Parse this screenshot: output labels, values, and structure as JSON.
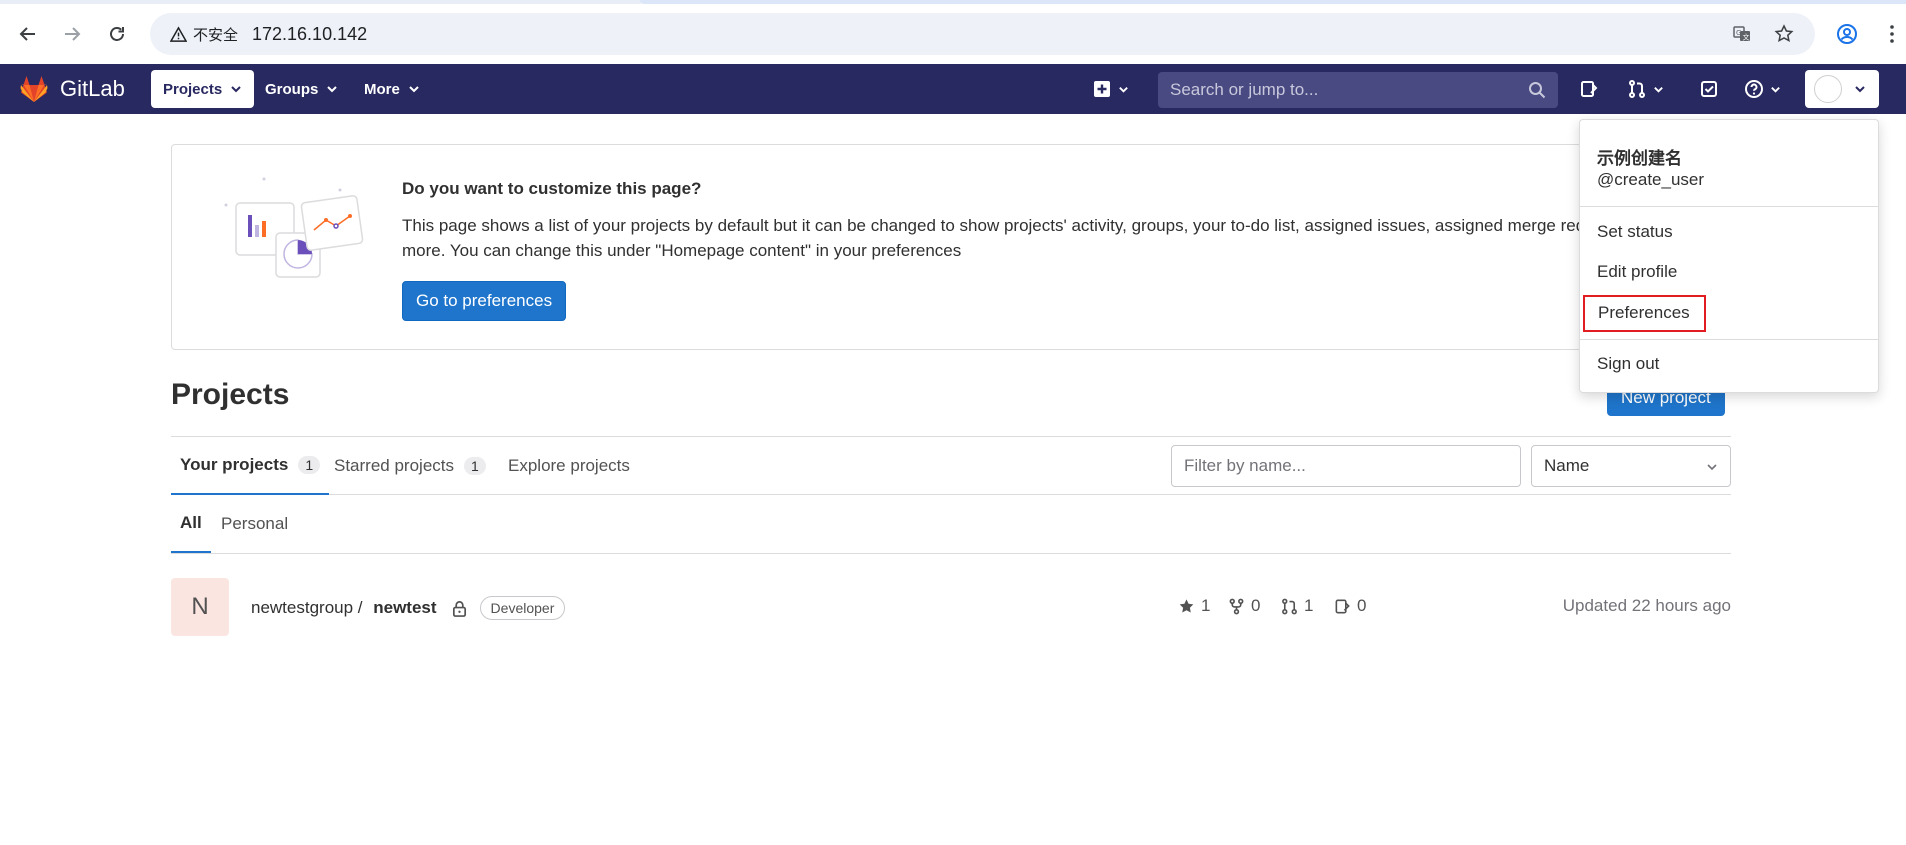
{
  "browser": {
    "security_label": "不安全",
    "url": "172.16.10.142",
    "icons": [
      "back-icon",
      "forward-icon",
      "reload-icon",
      "warning-icon",
      "translate-icon",
      "bookmark-star-icon",
      "tab-search-icon",
      "profile-icon",
      "more-menu-icon"
    ]
  },
  "header": {
    "brand": "GitLab",
    "nav": [
      {
        "label": "Projects",
        "active": true
      },
      {
        "label": "Groups",
        "active": false
      },
      {
        "label": "More",
        "active": false
      }
    ],
    "search_placeholder": "Search or jump to...",
    "icons": [
      "new-item-icon",
      "search-icon",
      "issues-icon",
      "merge-requests-icon",
      "todos-icon",
      "help-icon",
      "avatar"
    ]
  },
  "banner": {
    "title": "Do you want to customize this page?",
    "description": "This page shows a list of your projects by default but it can be changed to show projects' activity, groups, your to-do list, assigned issues, assigned merge requests, and more. You can change this under \"Homepage content\" in your preferences",
    "button": "Go to preferences"
  },
  "main": {
    "title": "Projects",
    "new_project": "New project",
    "tabs": [
      {
        "label": "Your projects",
        "count": "1",
        "active": true
      },
      {
        "label": "Starred projects",
        "count": "1",
        "active": false
      },
      {
        "label": "Explore projects",
        "count": null,
        "active": false
      }
    ],
    "filter_placeholder": "Filter by name...",
    "sort": "Name",
    "subtabs": [
      {
        "label": "All",
        "active": true
      },
      {
        "label": "Personal",
        "active": false
      }
    ],
    "projects": [
      {
        "avatar_letter": "N",
        "namespace": "newtestgroup / ",
        "name": "newtest",
        "visibility": "private",
        "role": "Developer",
        "stars": "1",
        "forks": "0",
        "merge_requests": "1",
        "issues": "0",
        "updated": "Updated 22 hours ago"
      }
    ]
  },
  "user_menu": {
    "name": "示例创建名",
    "handle": "@create_user",
    "items": [
      "Set status",
      "Edit profile",
      "Preferences",
      "Sign out"
    ],
    "highlighted": "Preferences"
  },
  "colors": {
    "header_bg": "#292961",
    "primary_button": "#1f75cb",
    "highlight_box": "#e11d21",
    "project_avatar_bg": "#fbe5e1"
  }
}
